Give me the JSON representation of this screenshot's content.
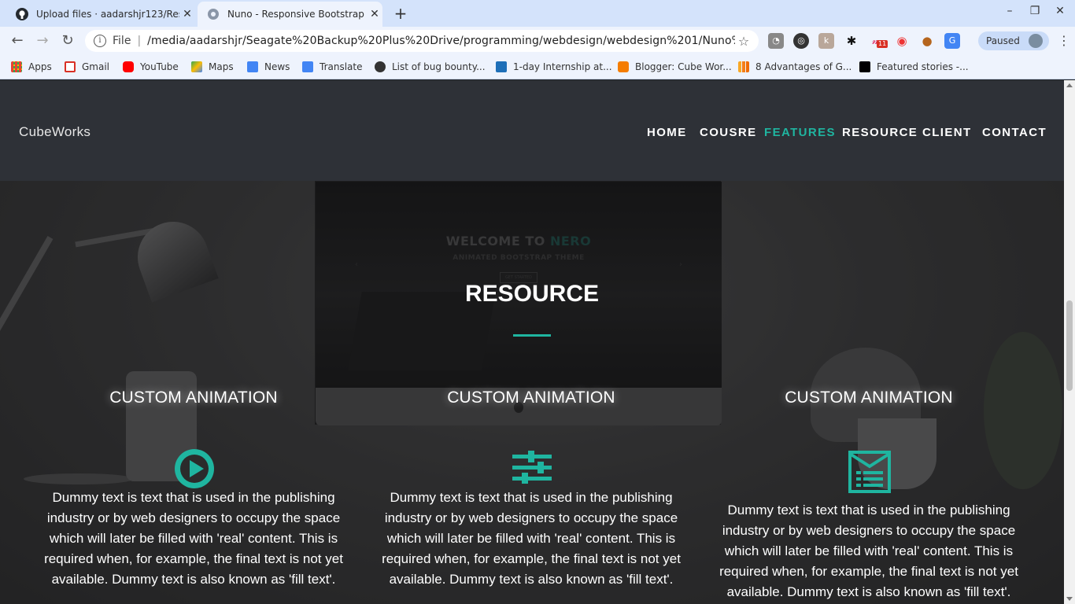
{
  "browser": {
    "tabs": [
      {
        "title": "Upload files · aadarshjr123/Res",
        "active": false
      },
      {
        "title": "Nuno - Responsive Bootstrap T",
        "active": true
      }
    ],
    "address": {
      "scheme": "File",
      "url": "/media/aadarshjr/Seagate%20Backup%20Plus%20Drive/programming/webdesign/webdesign%201/Nuno%2..."
    },
    "profile": {
      "status": "Paused"
    },
    "extension_badge": "11",
    "bookmarks": [
      "Apps",
      "Gmail",
      "YouTube",
      "Maps",
      "News",
      "Translate",
      "List of bug bounty...",
      "1-day Internship at...",
      "Blogger: Cube Wor...",
      "8 Advantages of G...",
      "Featured stories -..."
    ],
    "colors": {
      "tabstrip": "#d4e3fb",
      "toolbar": "#eef3fd"
    }
  },
  "site": {
    "logo": "CubeWorks",
    "nav": [
      {
        "label": "HOME",
        "active": false
      },
      {
        "label": "COUSRE",
        "active": false
      },
      {
        "label": "FEATURES",
        "active": true
      },
      {
        "label": "RESOURCE",
        "active": false
      },
      {
        "label": "CLIENT",
        "active": false
      },
      {
        "label": "CONTACT",
        "active": false
      }
    ],
    "monitor": {
      "title_a": "WELCOME TO",
      "title_b": "NERO",
      "subtitle": "ANIMATED BOOTSTRAP THEME",
      "button": "GET STARTED"
    },
    "section_title": "RESOURCE",
    "features": [
      {
        "title": "CUSTOM ANIMATION",
        "icon": "play-circle-icon",
        "text": "Dummy text is text that is used in the publishing industry or by web designers to occupy the space which will later be filled with 'real' content. This is required when, for example, the final text is not yet available. Dummy text is also known as 'fill text'."
      },
      {
        "title": "CUSTOM ANIMATION",
        "icon": "sliders-icon",
        "text": "Dummy text is text that is used in the publishing industry or by web designers to occupy the space which will later be filled with 'real' content. This is required when, for example, the final text is not yet available. Dummy text is also known as 'fill text'."
      },
      {
        "title": "CUSTOM ANIMATION",
        "icon": "newsletter-icon",
        "text": "Dummy text is text that is used in the publishing industry or by web designers to occupy the space which will later be filled with 'real' content. This is required when, for example, the final text is not yet available. Dummy text is also known as 'fill text'."
      }
    ],
    "colors": {
      "accent": "#1fb5a0",
      "header_bg": "#2e3137",
      "text": "#ffffff"
    }
  }
}
